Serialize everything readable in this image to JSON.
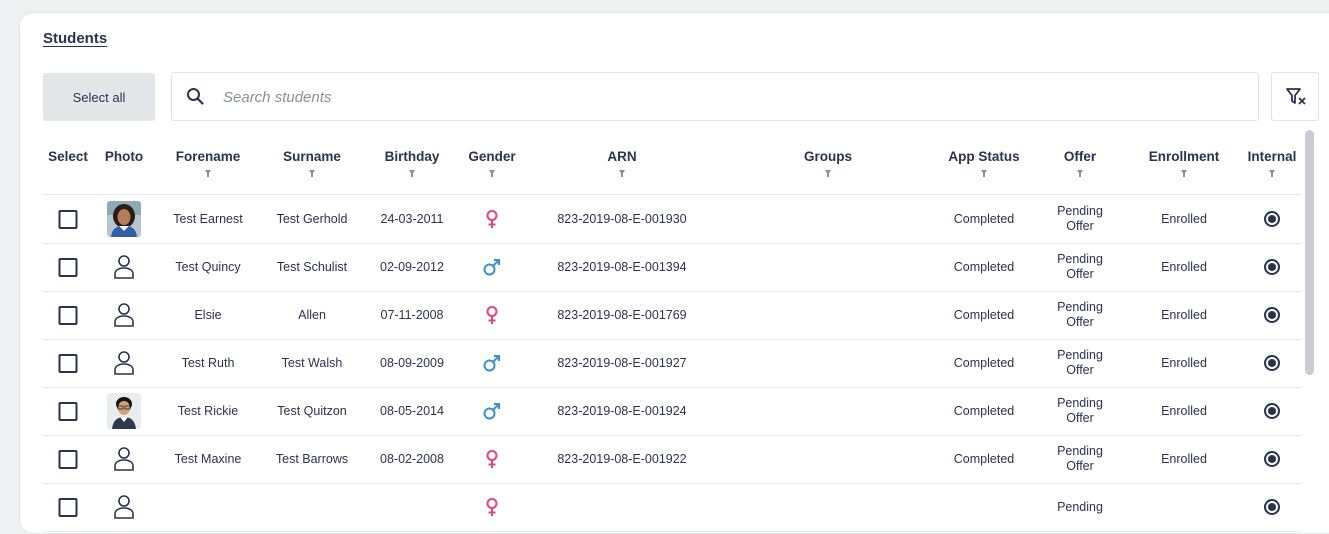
{
  "page": {
    "title": "Students"
  },
  "toolbar": {
    "select_all_label": "Select all",
    "search_placeholder": "Search students",
    "search_value": ""
  },
  "table": {
    "columns": [
      "Select",
      "Photo",
      "Forename",
      "Surname",
      "Birthday",
      "Gender",
      "ARN",
      "Groups",
      "App Status",
      "Offer",
      "Enrollment",
      "Internal"
    ],
    "sortable_columns": [
      "Forename",
      "Surname",
      "Birthday",
      "Gender",
      "ARN",
      "Groups",
      "App Status",
      "Offer",
      "Enrollment",
      "Internal"
    ],
    "rows": [
      {
        "photo": "photo",
        "forename": "Test Earnest",
        "surname": "Test Gerhold",
        "birthday": "24-03-2011",
        "gender": "female",
        "arn": "823-2019-08-E-001930",
        "groups": "",
        "app_status": "Completed",
        "offer_line1": "Pending",
        "offer_line2": "Offer",
        "enrollment": "Enrolled",
        "internal": true
      },
      {
        "photo": "placeholder",
        "forename": "Test Quincy",
        "surname": "Test Schulist",
        "birthday": "02-09-2012",
        "gender": "male",
        "arn": "823-2019-08-E-001394",
        "groups": "",
        "app_status": "Completed",
        "offer_line1": "Pending",
        "offer_line2": "Offer",
        "enrollment": "Enrolled",
        "internal": true
      },
      {
        "photo": "placeholder",
        "forename": "Elsie",
        "surname": "Allen",
        "birthday": "07-11-2008",
        "gender": "female",
        "arn": "823-2019-08-E-001769",
        "groups": "",
        "app_status": "Completed",
        "offer_line1": "Pending",
        "offer_line2": "Offer",
        "enrollment": "Enrolled",
        "internal": true
      },
      {
        "photo": "placeholder",
        "forename": "Test Ruth",
        "surname": "Test Walsh",
        "birthday": "08-09-2009",
        "gender": "male",
        "arn": "823-2019-08-E-001927",
        "groups": "",
        "app_status": "Completed",
        "offer_line1": "Pending",
        "offer_line2": "Offer",
        "enrollment": "Enrolled",
        "internal": true
      },
      {
        "photo": "photo",
        "forename": "Test Rickie",
        "surname": "Test Quitzon",
        "birthday": "08-05-2014",
        "gender": "male",
        "arn": "823-2019-08-E-001924",
        "groups": "",
        "app_status": "Completed",
        "offer_line1": "Pending",
        "offer_line2": "Offer",
        "enrollment": "Enrolled",
        "internal": true
      },
      {
        "photo": "placeholder",
        "forename": "Test Maxine",
        "surname": "Test Barrows",
        "birthday": "08-02-2008",
        "gender": "female",
        "arn": "823-2019-08-E-001922",
        "groups": "",
        "app_status": "Completed",
        "offer_line1": "Pending",
        "offer_line2": "Offer",
        "enrollment": "Enrolled",
        "internal": true
      },
      {
        "photo": "placeholder",
        "forename": "",
        "surname": "",
        "birthday": "",
        "gender": "female",
        "arn": "",
        "groups": "",
        "app_status": "",
        "offer_line1": "Pending",
        "offer_line2": "",
        "enrollment": "",
        "internal": true
      }
    ]
  },
  "colors": {
    "text": "#2a3350",
    "female": "#e0457b",
    "male": "#3d8fd0",
    "button_bg": "#e4e6ea"
  },
  "icons": {
    "search": "search-icon",
    "clear_filters": "filter-clear-icon",
    "female": "female-icon",
    "male": "male-icon",
    "placeholder_photo": "person-outline-icon"
  }
}
